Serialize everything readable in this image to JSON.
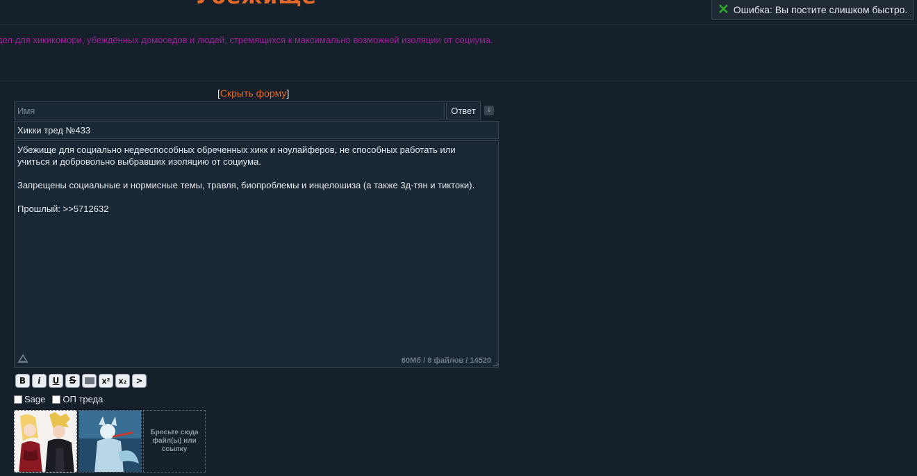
{
  "board": {
    "title": "Убежище",
    "description": "дел для хикикомори, убеждённых домоседов и людей, стремящихся к максимально возможной изоляции от социума."
  },
  "notification": {
    "icon": "close-icon",
    "text": "Ошибка: Вы постите слишком быстро."
  },
  "form": {
    "toggle_open": "[",
    "toggle_link": "Скрыть форму",
    "toggle_close": "]",
    "name_placeholder": "Имя",
    "name_value": "",
    "reply_button": "Ответ",
    "subject_value": "Хикки тред №433",
    "message_value": "Убежище для социально недееспособных обреченных хикк и ноулайферов, не способных работать или\nучиться и добровольно выбравших изоляцию от социума.\n\nЗапрещены социальные и нормисные темы, травля, биопроблемы и инцелошиза (а также 3д-тян и тиктоки).\n\nПрошлый: >>5712632",
    "counter": "60Мб / 8 файлов / 14520"
  },
  "markup_buttons": [
    {
      "name": "bold",
      "label": "B"
    },
    {
      "name": "italic",
      "label": "i"
    },
    {
      "name": "underline",
      "label": "U"
    },
    {
      "name": "strike",
      "label": "S"
    },
    {
      "name": "spoiler",
      "label": ""
    },
    {
      "name": "superscript",
      "label": "x²"
    },
    {
      "name": "subscript",
      "label": "x₂"
    },
    {
      "name": "quote",
      "label": ">"
    }
  ],
  "options": {
    "sage_label": "Sage",
    "op_label": "ОП треда"
  },
  "files": {
    "drop_text": "Бросьте сюда файл(ы) или ссылку"
  },
  "colors": {
    "accent": "#e5692a",
    "description": "#9d1f9a",
    "success_icon": "#2fa829"
  }
}
